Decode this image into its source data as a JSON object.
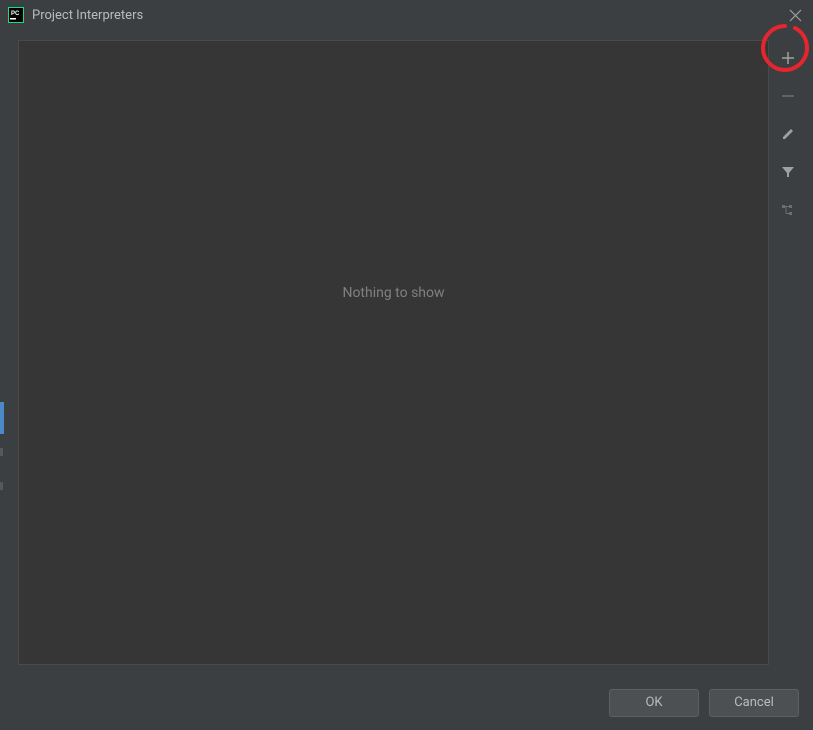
{
  "dialog": {
    "title": "Project Interpreters",
    "emptyMessage": "Nothing to show"
  },
  "toolbar": {
    "addTooltip": "Add",
    "removeTooltip": "Remove",
    "editTooltip": "Edit",
    "filterTooltip": "Filter",
    "treeTooltip": "Show paths"
  },
  "buttons": {
    "ok": "OK",
    "cancel": "Cancel"
  },
  "annotation": {
    "circleColor": "#e6252f"
  }
}
